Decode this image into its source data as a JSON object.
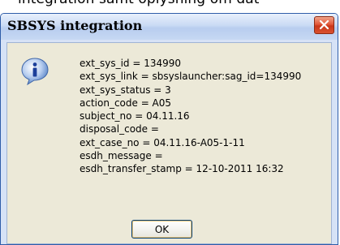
{
  "background_text": "integration samt oplysning om dat",
  "dialog": {
    "title": "SBSYS integration",
    "icon": "info-icon",
    "close_icon": "close-icon",
    "lines": [
      "ext_sys_id = 134990",
      "ext_sys_link = sbsyslauncher:sag_id=134990",
      "ext_sys_status = 3",
      "action_code = A05",
      "subject_no = 04.11.16",
      "disposal_code =",
      "ext_case_no = 04.11.16-A05-1-11",
      "esdh_message =",
      "esdh_transfer_stamp = 12-10-2011 16:32"
    ],
    "ok_label": "OK"
  },
  "colors": {
    "frame_border": "#2f5da8",
    "titlebar": "#c9daf4",
    "dialog_body": "#ece9d8",
    "close_button": "#d9512f"
  }
}
